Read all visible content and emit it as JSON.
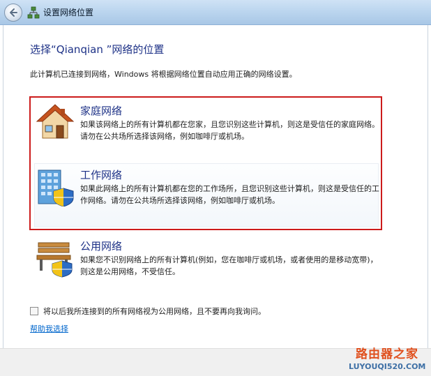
{
  "window": {
    "title": "设置网络位置"
  },
  "main": {
    "heading": "选择“Qianqian ”网络的位置",
    "description": "此计算机已连接到网络，Windows 将根据网络位置自动应用正确的网络设置。"
  },
  "options": [
    {
      "title": "家庭网络",
      "description": "如果该网络上的所有计算机都在您家，且您识别这些计算机，则这是受信任的家庭网络。请勿在公共场所选择该网络，例如咖啡厅或机场。",
      "icon": "house-icon"
    },
    {
      "title": "工作网络",
      "description": "如果此网络上的所有计算机都在您的工作场所，且您识别这些计算机，则这是受信任的工作网络。请勿在公共场所选择该网络，例如咖啡厅或机场。",
      "icon": "office-building-shield-icon"
    },
    {
      "title": "公用网络",
      "description": "如果您不识别网络上的所有计算机(例如，您在咖啡厅或机场，或者使用的是移动宽带)，则这是公用网络，不受信任。",
      "icon": "park-bench-shield-icon"
    }
  ],
  "checkbox": {
    "label": "将以后我所连接到的所有网络视为公用网络，且不要再向我询问。",
    "checked": false
  },
  "help_link": "帮助我选择",
  "watermark": {
    "line1": "路由器之家",
    "line2": "LUYOUQI520.COM"
  },
  "colors": {
    "heading": "#1e3287",
    "highlight_border": "#cc1b1b",
    "link": "#0066cc"
  }
}
